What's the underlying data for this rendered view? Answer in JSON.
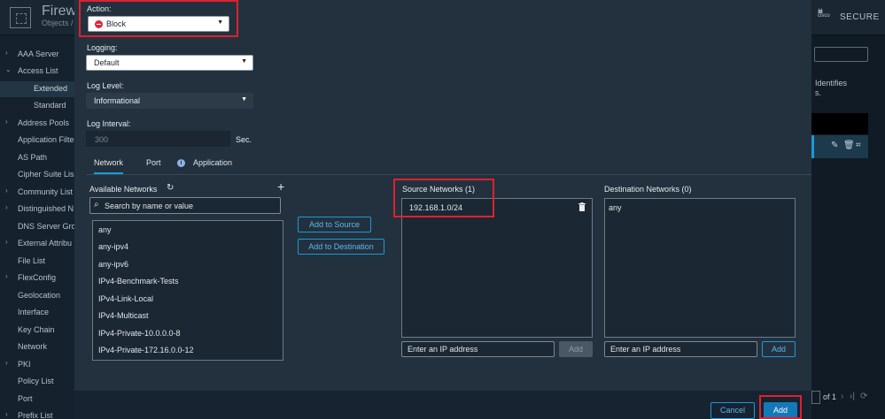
{
  "app": {
    "title": "Firewa",
    "breadcrumb": "Objects /",
    "brand_cisco": "cisco",
    "brand_secure": "SECURE"
  },
  "sidebar": {
    "items": [
      {
        "label": "AAA Server",
        "chevron": "›"
      },
      {
        "label": "Access List",
        "chevron": "⌄"
      },
      {
        "label": "Extended",
        "chevron": ""
      },
      {
        "label": "Standard",
        "chevron": ""
      },
      {
        "label": "Address Pools",
        "chevron": "›"
      },
      {
        "label": "Application Filte",
        "chevron": ""
      },
      {
        "label": "AS Path",
        "chevron": ""
      },
      {
        "label": "Cipher Suite Lis",
        "chevron": ""
      },
      {
        "label": "Community List",
        "chevron": "›"
      },
      {
        "label": "Distinguished N",
        "chevron": "›"
      },
      {
        "label": "DNS Server Gro",
        "chevron": ""
      },
      {
        "label": "External Attribu",
        "chevron": "›"
      },
      {
        "label": "File List",
        "chevron": ""
      },
      {
        "label": "FlexConfig",
        "chevron": "›"
      },
      {
        "label": "Geolocation",
        "chevron": ""
      },
      {
        "label": "Interface",
        "chevron": ""
      },
      {
        "label": "Key Chain",
        "chevron": ""
      },
      {
        "label": "Network",
        "chevron": ""
      },
      {
        "label": "PKI",
        "chevron": "›"
      },
      {
        "label": "Policy List",
        "chevron": ""
      },
      {
        "label": "Port",
        "chevron": ""
      },
      {
        "label": "Prefix List",
        "chevron": "›"
      }
    ]
  },
  "background": {
    "identifies_text": "Identifies",
    "dot_text": "s.",
    "pager_text": "of 1",
    "edit_icon": "✎",
    "delete_icon": "🗑",
    "binoculars_icon": "⌗"
  },
  "modal": {
    "action": {
      "label": "Action:",
      "value": "Block"
    },
    "logging": {
      "label": "Logging:",
      "value": "Default"
    },
    "log_level": {
      "label": "Log Level:",
      "value": "Informational"
    },
    "log_interval": {
      "label": "Log Interval:",
      "value": "300",
      "unit": "Sec."
    },
    "tabs": [
      "Network",
      "Port",
      "Application"
    ],
    "available": {
      "title": "Available Networks",
      "search_placeholder": "Search by name or value",
      "items": [
        "any",
        "any-ipv4",
        "any-ipv6",
        "IPv4-Benchmark-Tests",
        "IPv4-Link-Local",
        "IPv4-Multicast",
        "IPv4-Private-10.0.0.0-8",
        "IPv4-Private-172.16.0.0-12"
      ]
    },
    "add_to_source": "Add to Source",
    "add_to_destination": "Add to Destination",
    "source": {
      "title": "Source Networks (1)",
      "items": [
        "192.168.1.0/24"
      ],
      "input_placeholder": "Enter an IP address",
      "add_label": "Add"
    },
    "destination": {
      "title": "Destination Networks (0)",
      "items": [
        "any"
      ],
      "input_placeholder": "Enter an IP address",
      "add_label": "Add"
    },
    "footer": {
      "cancel": "Cancel",
      "add": "Add"
    }
  },
  "colors": {
    "accent": "#1a9ad6",
    "highlight": "#e0202e",
    "block": "#e2253a"
  }
}
